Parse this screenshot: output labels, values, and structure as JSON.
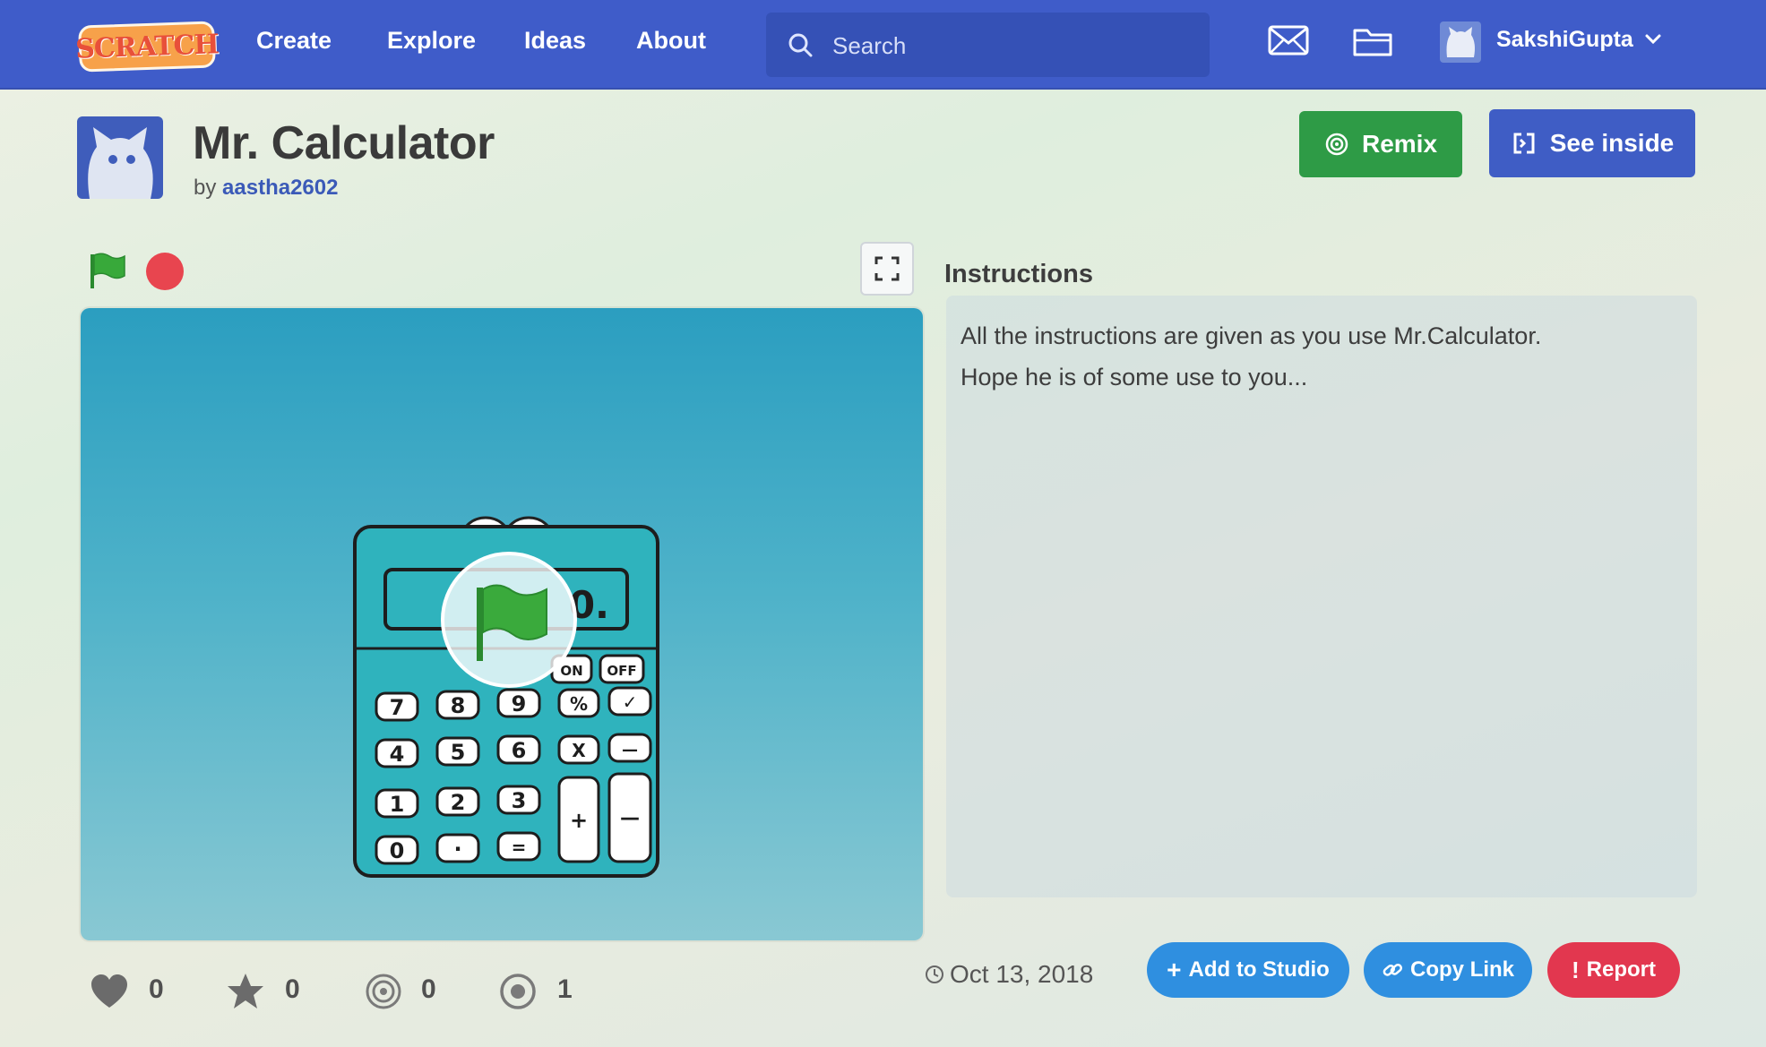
{
  "nav": {
    "logo_text": "SCRATCH",
    "links": [
      "Create",
      "Explore",
      "Ideas",
      "About"
    ],
    "search_placeholder": "Search",
    "user_name": "SakshiGupta",
    "icons": [
      "envelope-icon",
      "folder-icon",
      "chevron-down-icon"
    ],
    "bar_color": "#3f5cc9"
  },
  "project": {
    "title": "Mr. Calculator",
    "by_prefix": "by",
    "author": "aastha2602",
    "remix_label": "Remix",
    "see_inside_label": "See inside",
    "remix_color": "#2e9b46",
    "see_inside_color": "#3f5dc5"
  },
  "stage": {
    "display_value": "0.",
    "keys": [
      "ON",
      "OFF",
      "7",
      "8",
      "9",
      "%",
      "✓",
      "4",
      "5",
      "6",
      "X",
      "—",
      "1",
      "2",
      "3",
      "+",
      "—",
      "0",
      "·",
      "="
    ]
  },
  "instructions": {
    "heading": "Instructions",
    "text": "All the instructions are given as you use Mr.Calculator.\nHope he is of some use to you..."
  },
  "stats": {
    "loves": "0",
    "favorites": "0",
    "remixes": "0",
    "views": "1"
  },
  "footer": {
    "date": "Oct 13, 2018",
    "add_to_studio": "Add to Studio",
    "copy_link": "Copy Link",
    "report": "Report",
    "accent_blue": "#2f8fe0",
    "report_red": "#e2374f"
  }
}
